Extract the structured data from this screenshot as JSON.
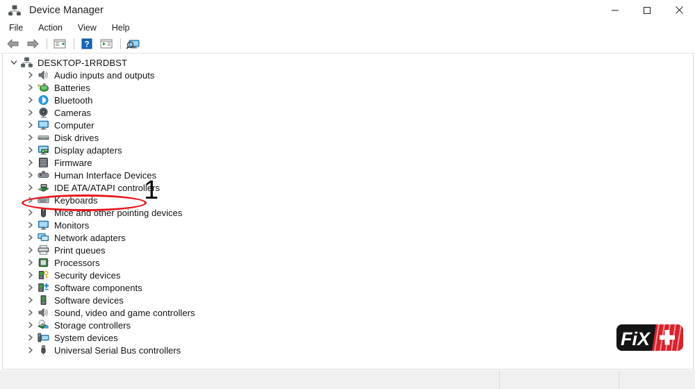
{
  "window": {
    "title": "Device Manager",
    "icon": "device-manager-icon",
    "controls": [
      {
        "name": "minimize-button",
        "glyph": "minimize-icon",
        "label": "Minimize"
      },
      {
        "name": "maximize-button",
        "glyph": "maximize-icon",
        "label": "Maximize"
      },
      {
        "name": "close-button",
        "glyph": "close-icon",
        "label": "Close"
      }
    ]
  },
  "menubar": {
    "items": [
      {
        "label": "File",
        "name": "menu-file"
      },
      {
        "label": "Action",
        "name": "menu-action"
      },
      {
        "label": "View",
        "name": "menu-view"
      },
      {
        "label": "Help",
        "name": "menu-help"
      }
    ]
  },
  "toolbar": {
    "buttons": [
      {
        "name": "back-button",
        "icon": "back-arrow-icon",
        "tooltip": "Back"
      },
      {
        "name": "forward-button",
        "icon": "forward-arrow-icon",
        "tooltip": "Forward"
      },
      {
        "name": "show-hide-console-tree-button",
        "icon": "console-tree-icon",
        "tooltip": "Show/Hide Console Tree"
      },
      {
        "name": "help-button",
        "icon": "help-question-icon",
        "tooltip": "Help"
      },
      {
        "name": "properties-button",
        "icon": "properties-icon",
        "tooltip": "Properties"
      },
      {
        "name": "scan-hardware-changes-button",
        "icon": "scan-monitor-icon",
        "tooltip": "Scan for hardware changes"
      }
    ]
  },
  "tree": {
    "root": {
      "label": "DESKTOP-1RRDBST",
      "icon": "computer-root-icon",
      "expanded": true
    },
    "nodes": [
      {
        "label": "Audio inputs and outputs",
        "icon": "speaker-icon"
      },
      {
        "label": "Batteries",
        "icon": "battery-icon"
      },
      {
        "label": "Bluetooth",
        "icon": "bluetooth-icon"
      },
      {
        "label": "Cameras",
        "icon": "camera-icon"
      },
      {
        "label": "Computer",
        "icon": "monitor-icon"
      },
      {
        "label": "Disk drives",
        "icon": "disk-drive-icon"
      },
      {
        "label": "Display adapters",
        "icon": "display-adapter-icon",
        "highlighted": true
      },
      {
        "label": "Firmware",
        "icon": "firmware-chip-icon"
      },
      {
        "label": "Human Interface Devices",
        "icon": "gamepad-icon"
      },
      {
        "label": "IDE ATA/ATAPI controllers",
        "icon": "ide-controller-icon"
      },
      {
        "label": "Keyboards",
        "icon": "keyboard-icon"
      },
      {
        "label": "Mice and other pointing devices",
        "icon": "mouse-icon"
      },
      {
        "label": "Monitors",
        "icon": "monitor-icon"
      },
      {
        "label": "Network adapters",
        "icon": "network-adapter-icon"
      },
      {
        "label": "Print queues",
        "icon": "printer-icon"
      },
      {
        "label": "Processors",
        "icon": "processor-chip-icon"
      },
      {
        "label": "Security devices",
        "icon": "security-key-icon"
      },
      {
        "label": "Software components",
        "icon": "software-components-icon"
      },
      {
        "label": "Software devices",
        "icon": "software-device-icon"
      },
      {
        "label": "Sound, video and game controllers",
        "icon": "speaker-icon"
      },
      {
        "label": "Storage controllers",
        "icon": "storage-controller-icon"
      },
      {
        "label": "System devices",
        "icon": "system-device-icon"
      },
      {
        "label": "Universal Serial Bus controllers",
        "icon": "usb-icon"
      }
    ]
  },
  "annotation": {
    "step_number": "1",
    "target_label": "Display adapters",
    "ellipse_color": "#e8131b"
  },
  "watermark": {
    "brand_text": "FiX",
    "brand_plus": "+",
    "colors": {
      "body": "#1b1b1b",
      "accent": "#e8131b",
      "text": "#ffffff"
    }
  },
  "statusbar": {
    "segments": [
      "",
      "",
      ""
    ]
  },
  "colors": {
    "window_bg": "#ffffff",
    "status_bg": "#f0f0f0",
    "text": "#111111",
    "chevron": "#5a5a5a",
    "accent_red": "#e8131b"
  }
}
